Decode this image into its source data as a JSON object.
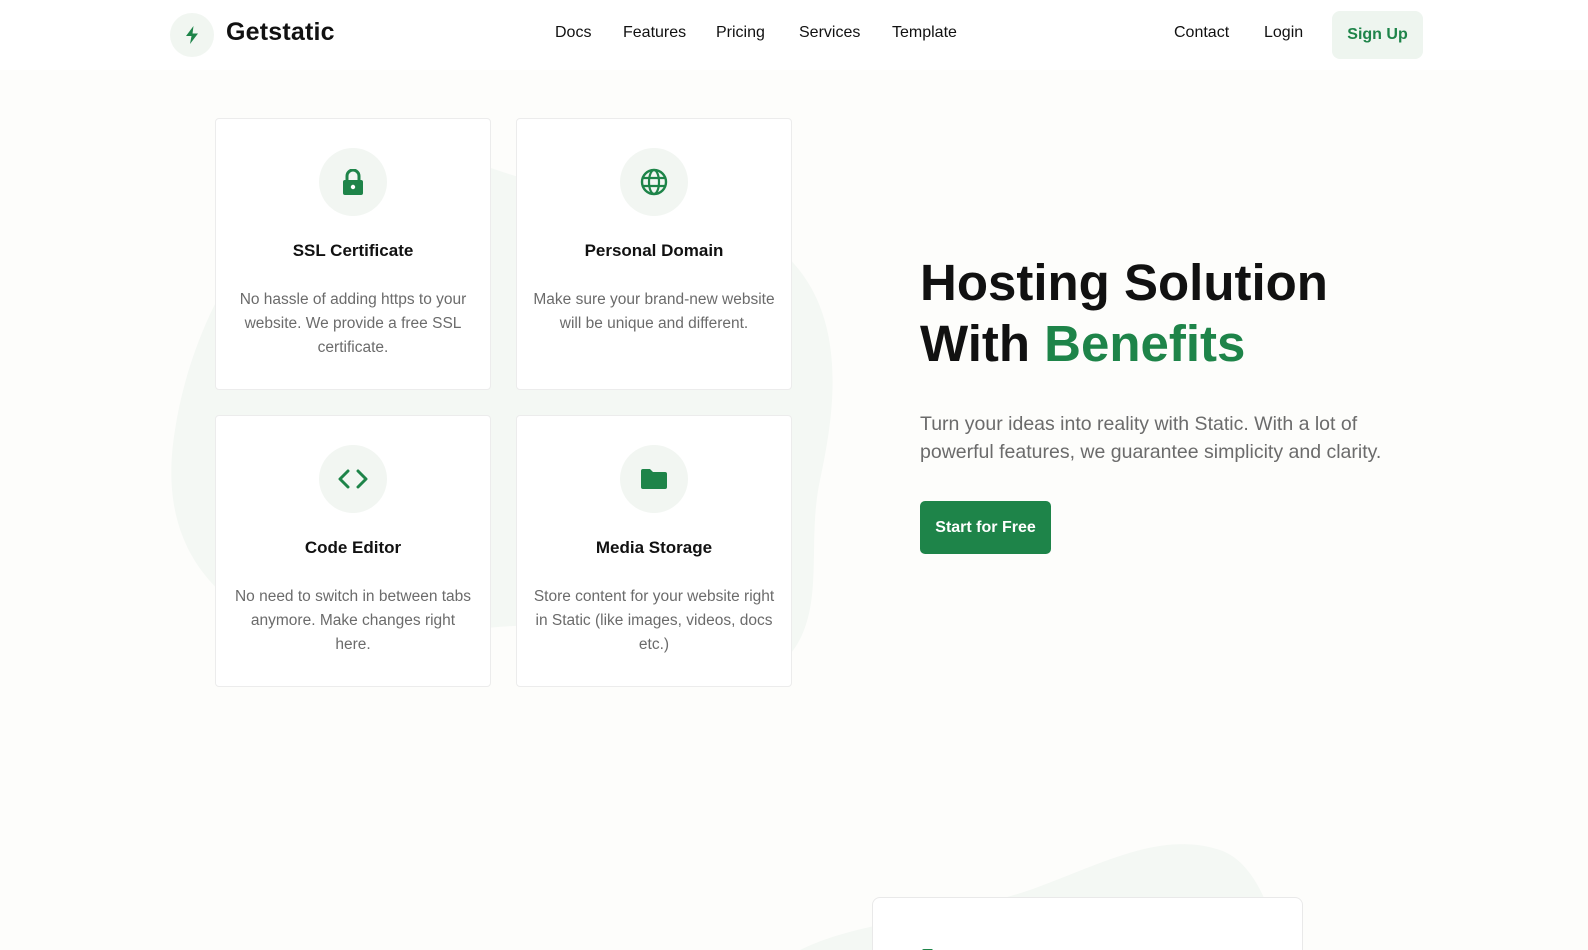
{
  "brand": {
    "name": "Getstatic",
    "logo_icon": "lightning-bolt-icon",
    "accent_color": "#1e8449"
  },
  "nav": {
    "items": [
      {
        "label": "Docs"
      },
      {
        "label": "Features"
      },
      {
        "label": "Pricing"
      },
      {
        "label": "Services"
      },
      {
        "label": "Template"
      }
    ],
    "contact": "Contact",
    "login": "Login",
    "signup": "Sign Up"
  },
  "features": [
    {
      "icon": "lock-icon",
      "title": "SSL Certificate",
      "description": "No hassle of adding https to your website. We provide a free SSL certificate."
    },
    {
      "icon": "globe-icon",
      "title": "Personal Domain",
      "description": "Make sure your brand-new website will be unique and different."
    },
    {
      "icon": "code-icon",
      "title": "Code Editor",
      "description": "No need to switch in between tabs anymore. Make changes right here."
    },
    {
      "icon": "folder-icon",
      "title": "Media Storage",
      "description": "Store content for your website right in Static (like images, videos, docs etc.)"
    }
  ],
  "hero": {
    "title_line1": "Hosting Solution",
    "title_line2_plain": "With ",
    "title_line2_accent": "Benefits",
    "subtitle": "Turn your ideas into reality with Static. With a lot of powerful features, we guarantee simplicity and clarity.",
    "cta": "Start for Free"
  }
}
